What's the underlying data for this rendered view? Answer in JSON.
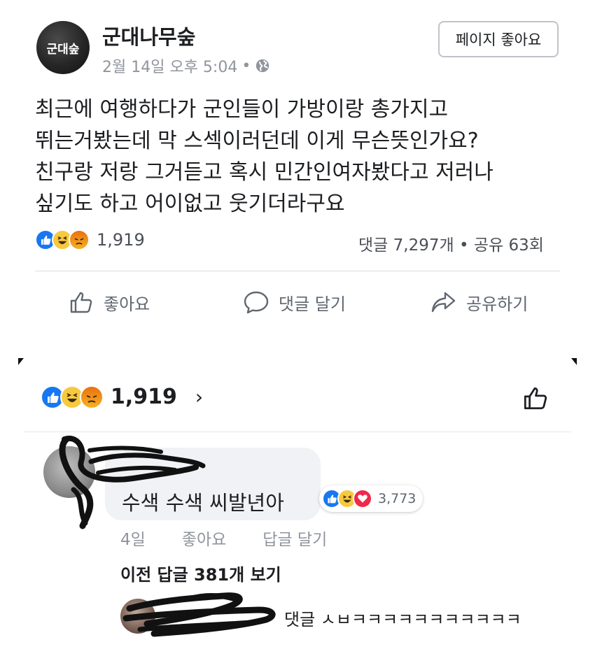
{
  "post": {
    "page_name": "군대나무숲",
    "avatar_text": "군대숲",
    "timestamp": "2월 14일 오후 5:04",
    "separator": "•",
    "privacy_icon": "globe-icon",
    "like_page_button": "페이지 좋아요",
    "body_lines": [
      "최근에 여행하다가 군인들이 가방이랑 총가지고",
      "뛰는거봤는데 막 스섹이러던데 이게 무슨뜻인가요?",
      "친구랑 저랑 그거듣고 혹시 민간인여자봤다고 저러나",
      "싶기도 하고 어이없고 웃기더라구요"
    ],
    "reaction_icons": [
      "like",
      "haha",
      "angry"
    ],
    "reaction_count": "1,919",
    "stats": "댓글 7,297개 • 공유 63회",
    "actions": {
      "like": "좋아요",
      "comment": "댓글 달기",
      "share": "공유하기"
    }
  },
  "reactions_panel": {
    "icons": [
      "like",
      "haha",
      "angry"
    ],
    "count": "1,919",
    "chevron": "›",
    "like_icon": "thumbs-up-icon"
  },
  "comment": {
    "text": "수색 수색 씨발년아",
    "reaction_icons": [
      "like",
      "haha",
      "love"
    ],
    "reaction_count": "3,773",
    "age": "4일",
    "like_label": "좋아요",
    "reply_label": "답글 달기",
    "view_replies": "이전 답글 381개 보기",
    "reply_preview": "댓글 ㅅㅂㅋㅋㅋㅋㅋㅋㅋㅋㅋㅋㅋ"
  },
  "colors": {
    "facebook_blue": "#1877f2",
    "text_primary": "#1c1e21",
    "text_secondary": "#90949c",
    "bubble_gray": "#f0f2f5",
    "haha_yellow": "#f7c93e",
    "angry_orange": "#e9710f",
    "love_red": "#f02849"
  }
}
